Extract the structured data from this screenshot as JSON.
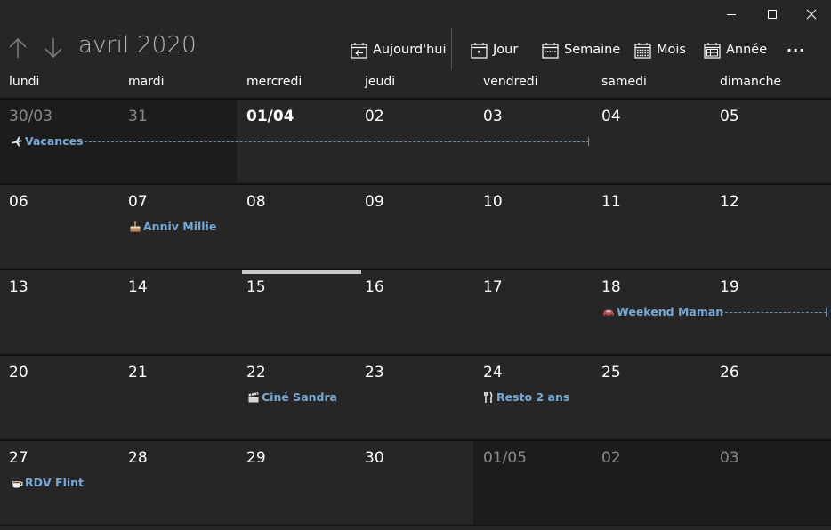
{
  "window": {
    "minimize_icon": "minimize-icon",
    "maximize_icon": "maximize-icon",
    "close_icon": "close-icon"
  },
  "header": {
    "month_title": "avril 2020",
    "toolbar": {
      "today": "Aujourd'hui",
      "day": "Jour",
      "week": "Semaine",
      "month": "Mois",
      "year": "Année",
      "more": "···"
    }
  },
  "weekdays": [
    "lundi",
    "mardi",
    "mercredi",
    "jeudi",
    "vendredi",
    "samedi",
    "dimanche"
  ],
  "weeks": [
    [
      "30/03",
      "31",
      "01/04",
      "02",
      "03",
      "04",
      "05"
    ],
    [
      "06",
      "07",
      "08",
      "09",
      "10",
      "11",
      "12"
    ],
    [
      "13",
      "14",
      "15",
      "16",
      "17",
      "18",
      "19"
    ],
    [
      "20",
      "21",
      "22",
      "23",
      "24",
      "25",
      "26"
    ],
    [
      "27",
      "28",
      "29",
      "30",
      "01/05",
      "02",
      "03"
    ]
  ],
  "events": {
    "vacances": "Vacances",
    "anniv_millie": "Anniv Millie",
    "weekend_maman": "Weekend Maman",
    "cine_sandra": "Ciné Sandra",
    "resto_2_ans": "Resto 2 ans",
    "rdv_flint": "RDV Flint"
  },
  "colors": {
    "accent_event": "#77a9d9",
    "background": "#262626",
    "dimmed_cell": "#1c1c1c"
  }
}
